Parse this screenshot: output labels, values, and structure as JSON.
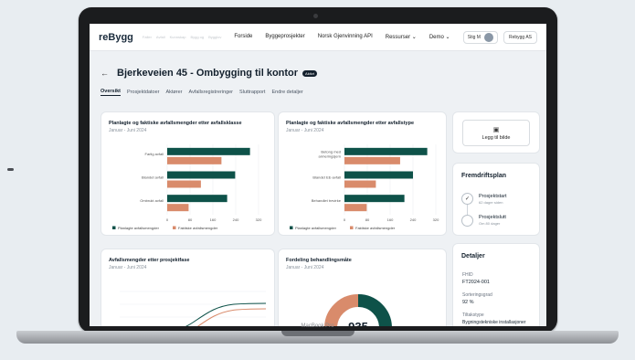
{
  "header": {
    "logo": "reBygg",
    "faint_links": [
      "Faller",
      "Avfall",
      "Kunnskap",
      "Bygg og",
      "Bygglov"
    ],
    "nav": [
      "Forside",
      "Byggeprosjekter",
      "Norsk Gjenvinning API",
      "Ressurser ⌄",
      "Demo ⌄"
    ],
    "user": "Stig M",
    "org": "Rebygg AS"
  },
  "page": {
    "title": "Bjerkeveien 45 - Ombygging til kontor",
    "status": "Aktivt",
    "tabs": [
      "Oversikt",
      "Prosjektdatoer",
      "Aktører",
      "Avfallsregistreringer",
      "Sluttrapport",
      "Endre detaljer"
    ]
  },
  "legend": {
    "planned": "Planlagte avfallsmengder",
    "actual": "Faktiske avfallsmengder"
  },
  "colors": {
    "planned": "#0e5249",
    "actual": "#d98b6b",
    "donut_base": "#e7eaee"
  },
  "chart_data": [
    {
      "type": "bar",
      "title": "Planlagte og faktiske avfallsmengder etter avfallsklasse",
      "subtitle": "Januar - Juni 2024",
      "categories": [
        "Farlig avfall",
        "Blandet avfall",
        "Ombrukt avfall"
      ],
      "series": [
        {
          "name": "Planlagte avfallsmengder",
          "values": [
            290,
            238,
            210
          ]
        },
        {
          "name": "Faktiske avfallsmengder",
          "values": [
            190,
            118,
            75
          ]
        }
      ],
      "xlim": [
        0,
        320
      ],
      "xticks": [
        0,
        80,
        160,
        240,
        320
      ],
      "grid": true,
      "legend": "bottom"
    },
    {
      "type": "bar",
      "title": "Planlagte og faktiske avfallsmengder etter avfallstype",
      "subtitle": "Januar - Juni 2024",
      "categories": [
        [
          "Betong med",
          "armeringsjern"
        ],
        [
          "Blandet EE-avfall"
        ],
        [
          "Behandlet trevirke"
        ]
      ],
      "series": [
        {
          "name": "Planlagte avfallsmengder",
          "values": [
            290,
            240,
            210
          ]
        },
        {
          "name": "Faktiske avfallsmengder",
          "values": [
            195,
            110,
            78
          ]
        }
      ],
      "xlim": [
        0,
        320
      ],
      "xticks": [
        0,
        80,
        160,
        240,
        320
      ],
      "grid": true,
      "legend": "bottom"
    }
  ],
  "phase_chart": {
    "title": "Avfallsmengder etter prosjektfase",
    "subtitle": "Januar - Juni 2024"
  },
  "donut": {
    "title": "Fordeling behandlingsmåte",
    "subtitle": "Januar - Juni 2024",
    "value": "935"
  },
  "sidebar": {
    "upload_label": "Legg til bilde",
    "progress_title": "Fremdriftsplan",
    "steps": [
      {
        "title": "Prosjektstart",
        "sub": "62 dager siden",
        "done": true
      },
      {
        "title": "Prosjektslutt",
        "sub": "Om 80 dager",
        "done": false
      }
    ],
    "details_title": "Detaljer",
    "details": [
      {
        "label": "FHID",
        "value": "FT2024-001"
      },
      {
        "label": "Sorteringsgrad",
        "value": "92 %"
      },
      {
        "label": "Tiltakstype",
        "value": "Bygningstekniske installasjoner"
      }
    ]
  },
  "device_label": "MacBook Pro"
}
